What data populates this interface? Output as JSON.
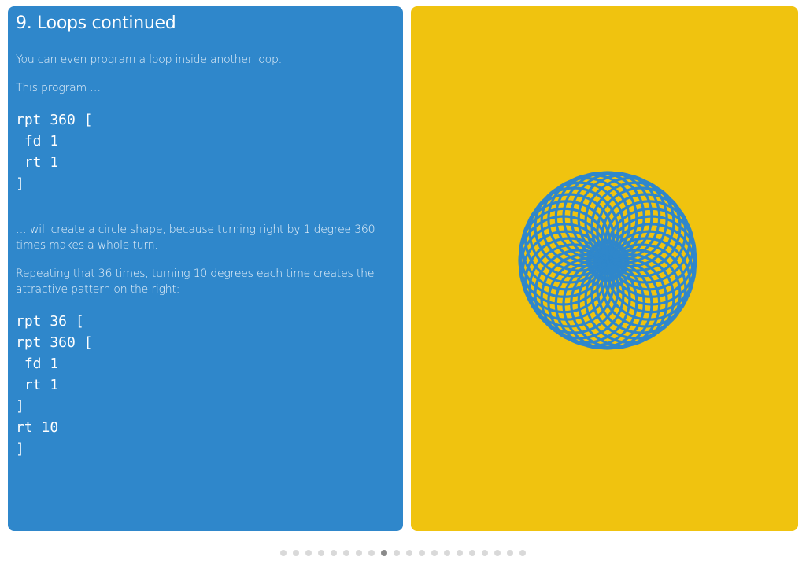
{
  "slide": {
    "title": "9. Loops continued",
    "para1": "You can even program a loop inside another loop.",
    "para2": "This program …",
    "code1": "rpt 360 [\n fd 1\n rt 1\n]",
    "para3": "… will create a circle shape, because turning right by 1 degree 360 times makes a whole turn.",
    "para4": "Repeating that 36 times, turning 10 degrees each time creates the attractive pattern on the right:",
    "code2": "rpt 36 [\nrpt 360 [\n fd 1\n rt 1\n]\nrt 10\n]"
  },
  "pattern": {
    "loop_count": 36,
    "step_degrees": 10,
    "stroke_color": "#2f87cb",
    "background_color": "#f0c30f"
  },
  "pagination": {
    "total": 20,
    "active_index": 8
  },
  "colors": {
    "left_panel": "#2f87cb",
    "right_panel": "#f0c30f",
    "dot": "#d9d9d9",
    "dot_active": "#8a8a8a"
  }
}
